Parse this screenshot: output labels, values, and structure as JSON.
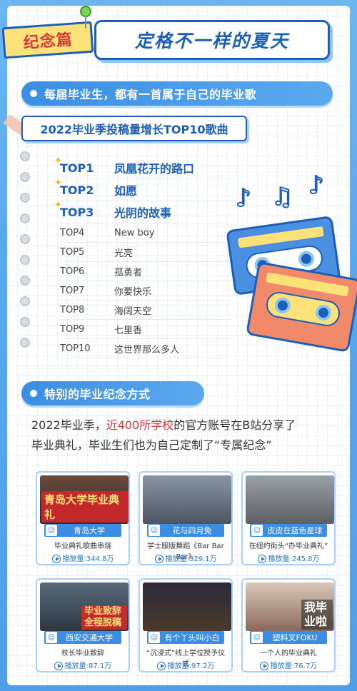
{
  "header": {
    "tag": "纪念篇",
    "title": "定格不一样的夏天"
  },
  "section1": {
    "title": "每届毕业生，都有一首属于自己的毕业歌"
  },
  "top10": {
    "title": "2022毕业季投稿量增长TOP10歌曲",
    "items": [
      {
        "rank": "TOP1",
        "name": "凤凰花开的路口"
      },
      {
        "rank": "TOP2",
        "name": "如愿"
      },
      {
        "rank": "TOP3",
        "name": "光阴的故事"
      },
      {
        "rank": "TOP4",
        "name": "New boy"
      },
      {
        "rank": "TOP5",
        "name": "光亮"
      },
      {
        "rank": "TOP6",
        "name": "孤勇者"
      },
      {
        "rank": "TOP7",
        "name": "你要快乐"
      },
      {
        "rank": "TOP8",
        "name": "海阔天空"
      },
      {
        "rank": "TOP9",
        "name": "七里香"
      },
      {
        "rank": "TOP10",
        "name": "这世界那么多人"
      }
    ]
  },
  "section2": {
    "title": "特别的毕业纪念方式"
  },
  "desc": {
    "p1_pre": "2022毕业季，",
    "p1_hl": "近400所学校",
    "p1_post": "的官方账号在B站分享了",
    "p2": "毕业典礼，毕业生们也为自己定制了“专属纪念”"
  },
  "cards": [
    {
      "author": "青岛大学",
      "title": "毕业典礼歌曲串烧",
      "plays": "播放量:344.8万",
      "caption": "青岛大学毕业典礼"
    },
    {
      "author": "花与四月兔",
      "title": "学士服版舞蹈《Bar Bar Bar》",
      "plays": "播放量:329.1万",
      "caption": ""
    },
    {
      "author": "皮皮在蓝色星球",
      "title": "在纽约街头“办毕业典礼”",
      "plays": "播放量:245.8万",
      "caption": ""
    },
    {
      "author": "西安交通大学",
      "title": "校长毕业致辞",
      "plays": "播放量:87.1万",
      "caption": "毕业致辞 全程脱稿"
    },
    {
      "author": "有个丫头叫小白",
      "title": "“沉浸式”线上学位授予仪式",
      "plays": "播放量:97.2万",
      "caption": ""
    },
    {
      "author": "塑料叉FOKU",
      "title": "一个人的毕业典礼",
      "plays": "播放量:76.7万",
      "caption": "我毕 业啦"
    }
  ],
  "colors": {
    "primary": "#1d5fb8",
    "accent": "#3b8ee3",
    "highlight": "#d83a3a",
    "yellow": "#fde27a"
  }
}
